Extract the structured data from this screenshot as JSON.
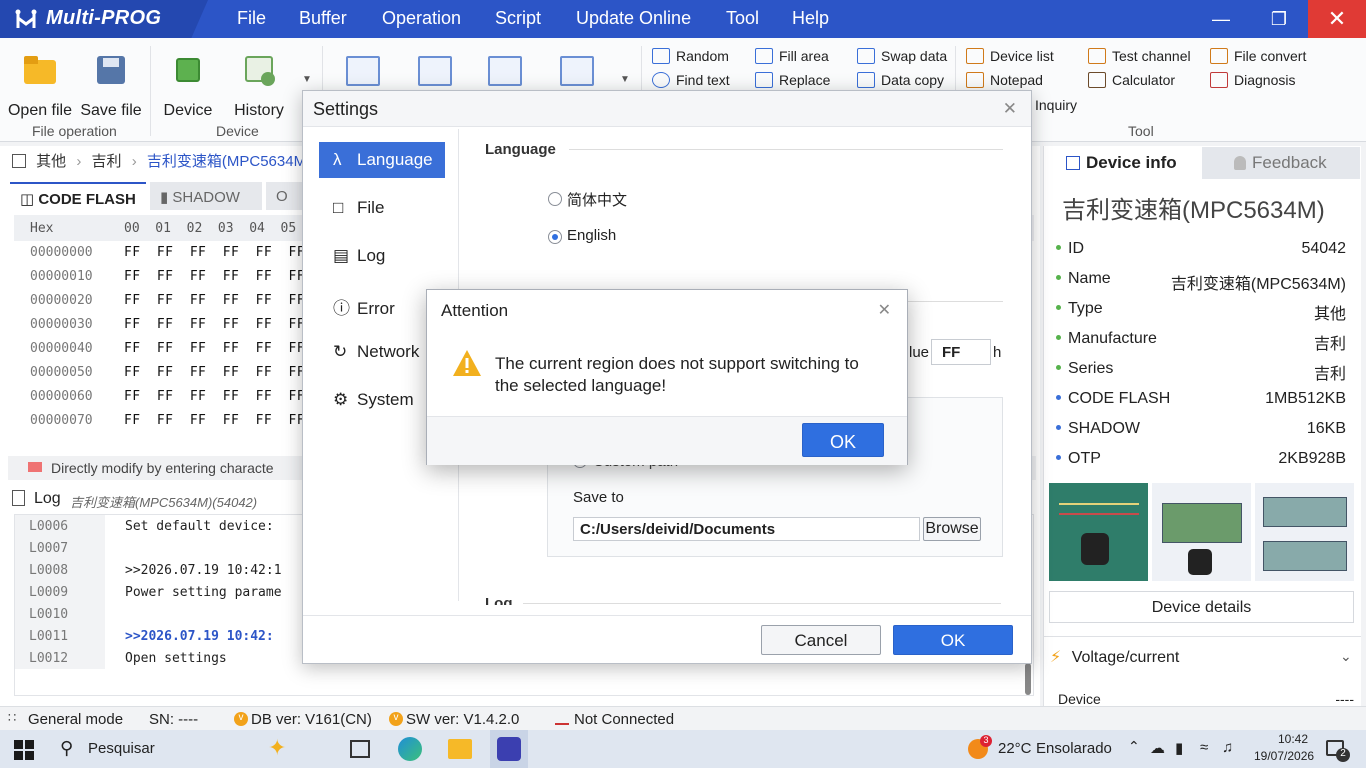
{
  "app": {
    "title": "Multi-PROG"
  },
  "menu": [
    "File",
    "Buffer",
    "Operation",
    "Script",
    "Update Online",
    "Tool",
    "Help"
  ],
  "ribbon": {
    "open_file": "Open file",
    "save_file": "Save file",
    "device": "Device",
    "history": "History",
    "group_file": "File operation",
    "group_device": "Device",
    "group_tool": "Tool",
    "random": "Random",
    "find_text": "Find text",
    "fill_area": "Fill area",
    "replace": "Replace",
    "swap_data": "Swap data",
    "data_copy": "Data copy",
    "device_list": "Device list",
    "notepad": "Notepad",
    "test_channel": "Test channel",
    "calculator": "Calculator",
    "file_convert": "File convert",
    "diagnosis": "Diagnosis",
    "inquiry": "Inquiry"
  },
  "breadcrumb": [
    "其他",
    "吉利",
    "吉利变速箱(MPC5634M"
  ],
  "tabs": [
    "CODE FLASH",
    "SHADOW",
    "O"
  ],
  "hex": {
    "header_label": "Hex",
    "columns": "00  01  02  03  04  05  06",
    "rows": [
      {
        "addr": "00000000",
        "bytes": "FF  FF  FF  FF  FF  FF  F"
      },
      {
        "addr": "00000010",
        "bytes": "FF  FF  FF  FF  FF  FF  F"
      },
      {
        "addr": "00000020",
        "bytes": "FF  FF  FF  FF  FF  FF  F"
      },
      {
        "addr": "00000030",
        "bytes": "FF  FF  FF  FF  FF  FF  F"
      },
      {
        "addr": "00000040",
        "bytes": "FF  FF  FF  FF  FF  FF  F"
      },
      {
        "addr": "00000050",
        "bytes": "FF  FF  FF  FF  FF  FF  F"
      },
      {
        "addr": "00000060",
        "bytes": "FF  FF  FF  FF  FF  FF  F"
      },
      {
        "addr": "00000070",
        "bytes": "FF  FF  FF  FF  FF  FF  F"
      }
    ]
  },
  "modify_hint": "Directly modify by entering characte",
  "log": {
    "title": "Log",
    "subtitle": "吉利变速箱(MPC5634M)(54042)",
    "lines": [
      {
        "no": "L0006",
        "text": "Set default device:"
      },
      {
        "no": "L0007",
        "text": ""
      },
      {
        "no": "L0008",
        "text": ">>2026.07.19 10:42:1"
      },
      {
        "no": "L0009",
        "text": "Power setting parame"
      },
      {
        "no": "L0010",
        "text": ""
      },
      {
        "no": "L0011",
        "text": ">>2026.07.19 10:42:"
      },
      {
        "no": "L0012",
        "text": "Open settings"
      }
    ]
  },
  "device_info": {
    "tab_info": "Device info",
    "tab_feedback": "Feedback",
    "title": "吉利变速箱(MPC5634M)",
    "rows": [
      {
        "k": "ID",
        "v": "54042"
      },
      {
        "k": "Name",
        "v": "吉利变速箱(MPC5634M)"
      },
      {
        "k": "Type",
        "v": "其他"
      },
      {
        "k": "Manufacture",
        "v": "吉利"
      },
      {
        "k": "Series",
        "v": "吉利"
      },
      {
        "k": "CODE FLASH",
        "v": "1MB512KB"
      },
      {
        "k": "SHADOW",
        "v": "16KB"
      },
      {
        "k": "OTP",
        "v": "2KB928B"
      }
    ],
    "details_button": "Device details",
    "voltage_title": "Voltage/current",
    "voltage_device": "Device",
    "voltage_value": "----"
  },
  "settings": {
    "title": "Settings",
    "nav": [
      "Language",
      "File",
      "Log",
      "Error",
      "Network",
      "System"
    ],
    "section_language": "Language",
    "opt_chinese": "简体中文",
    "opt_english": "English",
    "value_label": "lue",
    "value_field": "FF",
    "value_suffix": "h",
    "custom_path": "Custom path",
    "save_to": "Save to",
    "path": "C:/Users/deivid/Documents",
    "browse": "Browse",
    "section_log": "Log",
    "cancel": "Cancel",
    "ok": "OK"
  },
  "attention": {
    "title": "Attention",
    "message_1": "The current region does not support switching to",
    "message_2": "the selected language!",
    "ok": "OK"
  },
  "status": {
    "mode": "General mode",
    "sn": "SN:  ----",
    "db": "DB ver: V161(CN)",
    "sw": "SW ver: V1.4.2.0",
    "conn": "Not Connected"
  },
  "taskbar": {
    "search": "Pesquisar",
    "weather_temp": "22°C",
    "weather_text": "Ensolarado",
    "weather_badge": "3",
    "time": "10:42",
    "date": "19/07/2026",
    "notif_count": "2"
  },
  "colors": {
    "accent": "#2c55c7",
    "primary_button": "#2f6fe0",
    "warning": "#f2b01e"
  }
}
